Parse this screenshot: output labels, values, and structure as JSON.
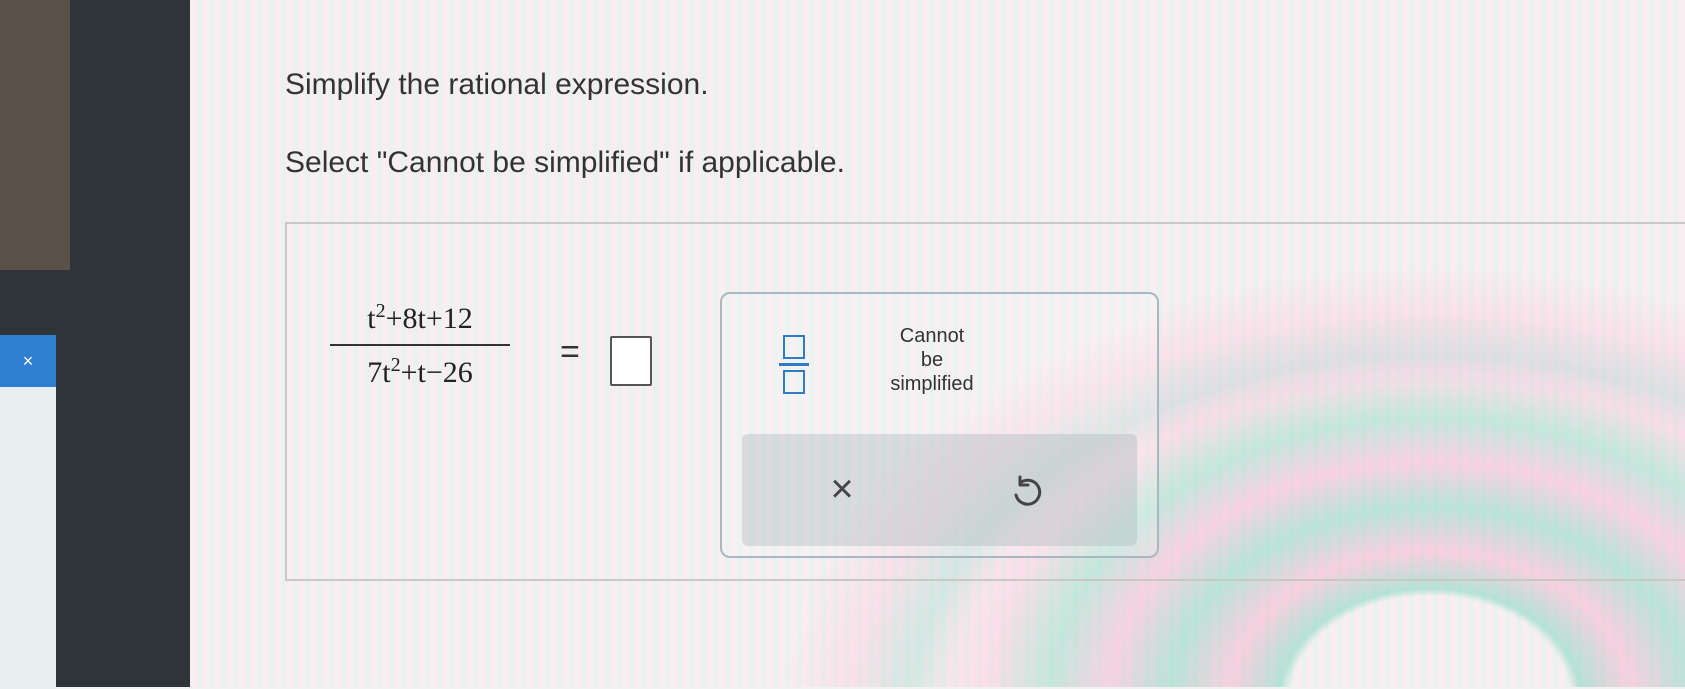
{
  "question": {
    "line1": "Simplify the rational expression.",
    "line2": "Select \"Cannot be simplified\" if applicable."
  },
  "expression": {
    "numerator": {
      "base1": "t",
      "exp1": "2",
      "rest": "+8t+12"
    },
    "denominator": {
      "base1": "7t",
      "exp1": "2",
      "rest": "+t−26"
    },
    "equals": "="
  },
  "keypad": {
    "cannot": {
      "line1": "Cannot",
      "line2": "be",
      "line3": "simplified"
    },
    "clear_symbol": "×"
  },
  "side_window": {
    "tab_symbol": "×"
  },
  "colors": {
    "accent": "#2e7cc7",
    "text": "#333333"
  }
}
